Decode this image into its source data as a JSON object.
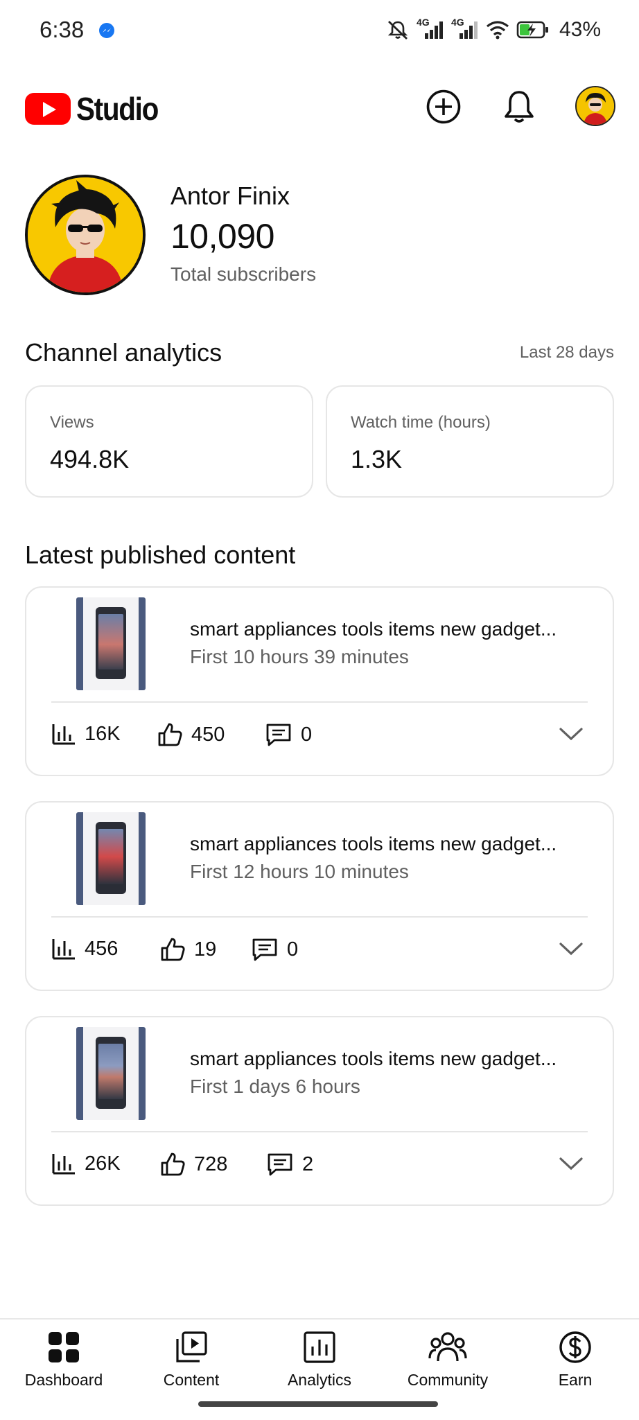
{
  "status_bar": {
    "time": "6:38",
    "battery": "43%",
    "network_1": "4G",
    "network_2": "4G"
  },
  "header": {
    "logo_text": "Studio"
  },
  "channel": {
    "name": "Antor Finix",
    "subscribers": "10,090",
    "subscribers_label": "Total subscribers"
  },
  "analytics": {
    "title": "Channel analytics",
    "period": "Last 28 days",
    "cards": [
      {
        "label": "Views",
        "value": "494.8K"
      },
      {
        "label": "Watch time (hours)",
        "value": "1.3K"
      }
    ]
  },
  "latest": {
    "title": "Latest published content",
    "items": [
      {
        "title": "smart appliances tools items new gadget...",
        "time": "First 10 hours 39 minutes",
        "views": "16K",
        "likes": "450",
        "comments": "0"
      },
      {
        "title": "smart appliances tools items new gadget...",
        "time": "First 12 hours 10 minutes",
        "views": "456",
        "likes": "19",
        "comments": "0"
      },
      {
        "title": "smart appliances tools items new gadget...",
        "time": "First 1 days 6 hours",
        "views": "26K",
        "likes": "728",
        "comments": "2"
      }
    ]
  },
  "nav": {
    "items": [
      {
        "label": "Dashboard",
        "icon": "dashboard-icon"
      },
      {
        "label": "Content",
        "icon": "content-icon"
      },
      {
        "label": "Analytics",
        "icon": "analytics-icon"
      },
      {
        "label": "Community",
        "icon": "community-icon"
      },
      {
        "label": "Earn",
        "icon": "earn-icon"
      }
    ]
  },
  "colors": {
    "brand_red": "#ff0000",
    "text_primary": "#0f0f0f",
    "text_secondary": "#606060",
    "card_border": "#e6e6e6"
  }
}
